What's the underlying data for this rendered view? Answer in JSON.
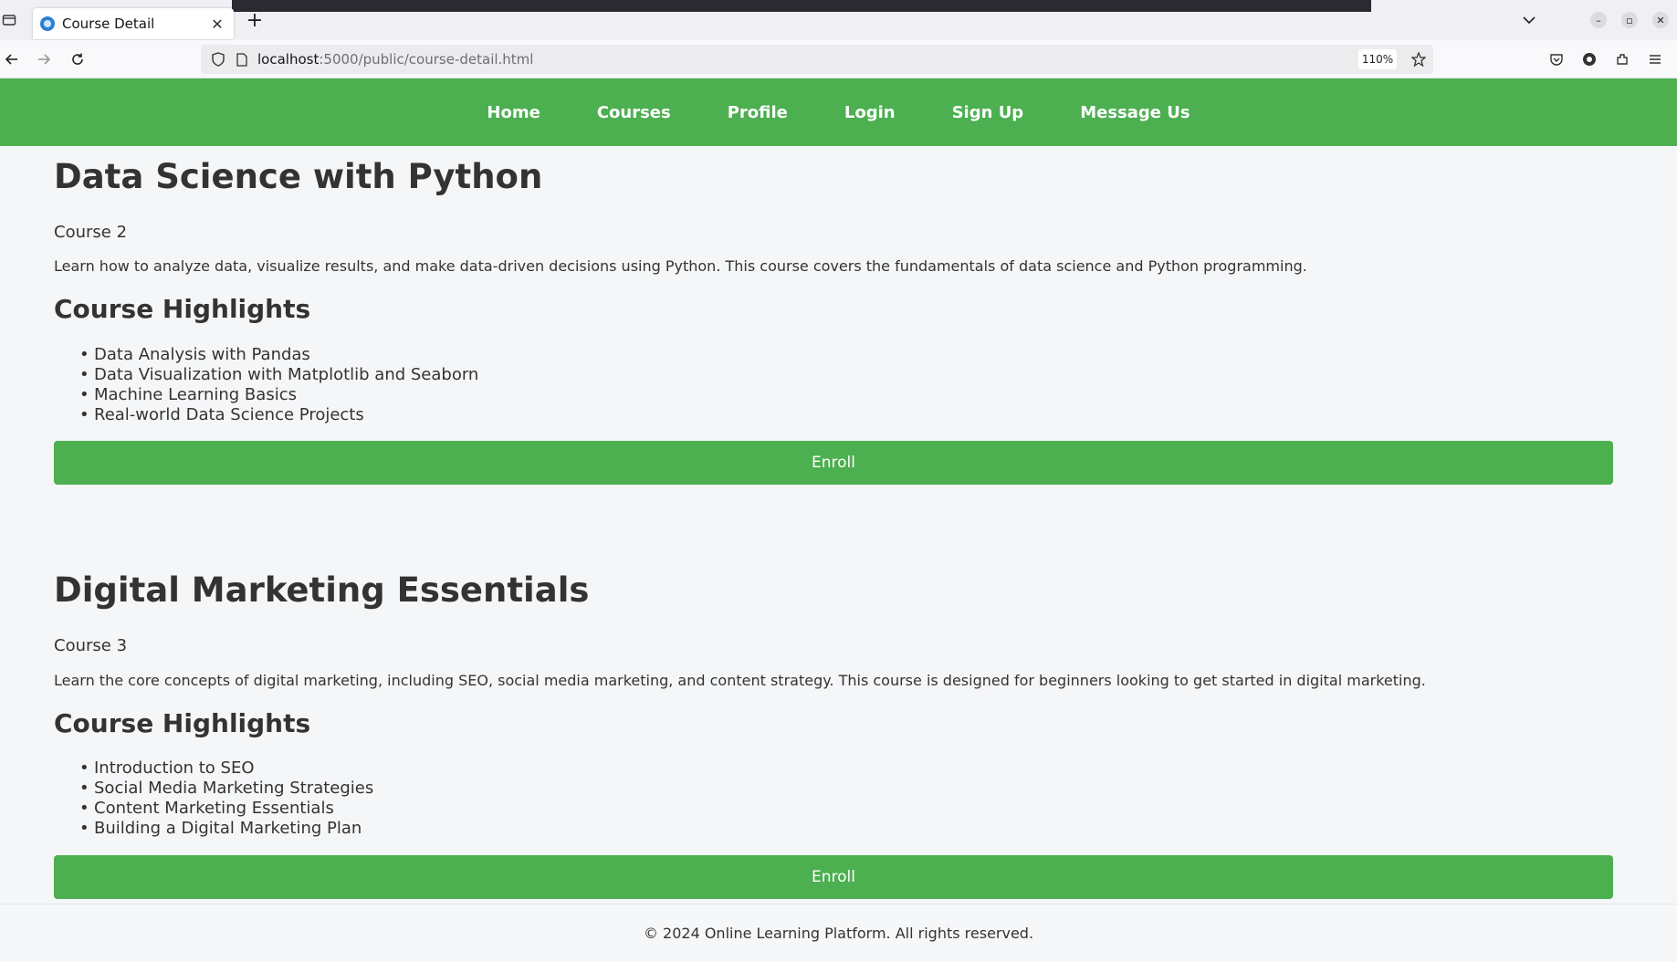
{
  "browser": {
    "tab_title": "Course Detail",
    "url_host": "localhost",
    "url_rest": ":5000/public/course-detail.html",
    "zoom": "110%"
  },
  "site_nav": {
    "links": [
      "Home",
      "Courses",
      "Profile",
      "Login",
      "Sign Up",
      "Message Us"
    ]
  },
  "courses": [
    {
      "title": "Data Science with Python",
      "number": "Course 2",
      "description": "Learn how to analyze data, visualize results, and make data-driven decisions using Python. This course covers the fundamentals of data science and Python programming.",
      "highlights_heading": "Course Highlights",
      "highlights": [
        "Data Analysis with Pandas",
        "Data Visualization with Matplotlib and Seaborn",
        "Machine Learning Basics",
        "Real-world Data Science Projects"
      ],
      "enroll_label": "Enroll"
    },
    {
      "title": "Digital Marketing Essentials",
      "number": "Course 3",
      "description": "Learn the core concepts of digital marketing, including SEO, social media marketing, and content strategy. This course is designed for beginners looking to get started in digital marketing.",
      "highlights_heading": "Course Highlights",
      "highlights": [
        "Introduction to SEO",
        "Social Media Marketing Strategies",
        "Content Marketing Essentials",
        "Building a Digital Marketing Plan"
      ],
      "enroll_label": "Enroll"
    }
  ],
  "footer": {
    "text": "© 2024 Online Learning Platform. All rights reserved."
  },
  "colors": {
    "accent": "#4caf50",
    "background": "#f4f6f8",
    "text": "#333333"
  }
}
